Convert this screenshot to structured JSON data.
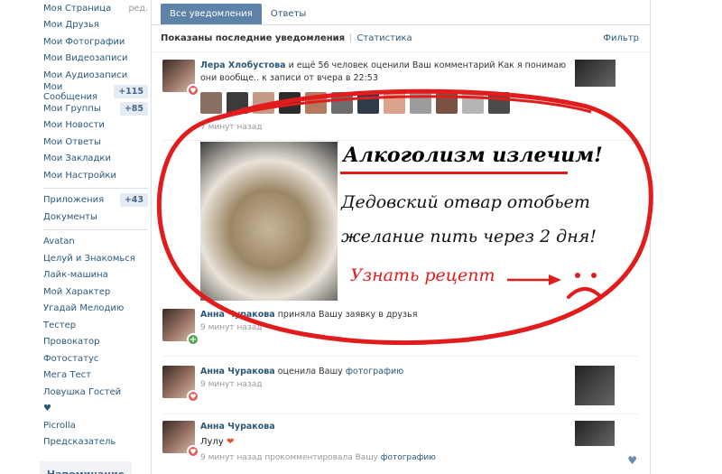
{
  "sidebar": {
    "top_items": [
      {
        "label": "Моя Страница",
        "extra": "ред."
      },
      {
        "label": "Мои Друзья"
      },
      {
        "label": "Мои Фотографии"
      },
      {
        "label": "Мои Видеозаписи"
      },
      {
        "label": "Мои Аудиозаписи"
      },
      {
        "label": "Мои Сообщения",
        "badge": "+115"
      },
      {
        "label": "Мои Группы",
        "badge": "+85"
      },
      {
        "label": "Мои Новости"
      },
      {
        "label": "Мои Ответы"
      },
      {
        "label": "Мои Закладки"
      },
      {
        "label": "Мои Настройки"
      }
    ],
    "app_items": [
      {
        "label": "Приложения",
        "badge": "+43"
      },
      {
        "label": "Документы"
      }
    ],
    "game_items": [
      {
        "label": "Avatan"
      },
      {
        "label": "Целуй и Знакомься"
      },
      {
        "label": "Лайк-машина"
      },
      {
        "label": "Мой Характер"
      },
      {
        "label": "Угадай Мелодию"
      },
      {
        "label": "Тестер"
      },
      {
        "label": "Провокатор"
      },
      {
        "label": "Фотостатус"
      },
      {
        "label": "Мега Тест"
      },
      {
        "label": "Ловушка Гостей"
      },
      {
        "label": "♥"
      },
      {
        "label": "Picrolla"
      },
      {
        "label": "Предсказатель"
      }
    ],
    "reminder": "Напоминание"
  },
  "tabs": {
    "all": "Все уведомления",
    "replies": "Ответы"
  },
  "subbar": {
    "shown": "Показаны последние уведомления",
    "separator": "|",
    "stats": "Статистика",
    "filter": "Фильтр"
  },
  "notifications": [
    {
      "name": "Лера Хлобустова",
      "text": " и ещё 56 человек оценили Ваш комментарий Как я понимаю они вообще.. к записи от вчера в 22:53",
      "time": "7 минут назад"
    },
    {
      "name": "Анна Чуракова",
      "text": " приняла Вашу заявку в друзья",
      "time": "9 минут назад"
    },
    {
      "name": "Анна Чуракова",
      "text": " оценила Вашу ",
      "link": "фотографию",
      "time": "9 минут назад"
    },
    {
      "name": "Анна Чуракова",
      "comment": "Лулу",
      "time": "9 минут назад прокомментировала Вашу ",
      "link": "фотографию"
    }
  ],
  "ad": {
    "title": "Алкоголизм излечим!",
    "line1": "Дедовский отвар отобьет",
    "line2": "желание пить через 2 дня!",
    "cta": "Узнать рецепт"
  },
  "colors": {
    "accent": "#5e82a8",
    "link": "#2b587a",
    "ad_red": "#e21c1c"
  }
}
